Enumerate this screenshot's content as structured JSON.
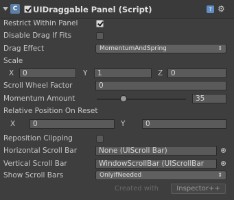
{
  "header": {
    "icon_letter": "C",
    "title": "UIDraggable Panel (Script)",
    "enabled": true
  },
  "fields": {
    "restrict_within_panel": {
      "label": "Restrict Within Panel",
      "checked": true
    },
    "disable_drag_if_fits": {
      "label": "Disable Drag If Fits",
      "checked": false
    },
    "drag_effect": {
      "label": "Drag Effect",
      "value": "MomentumAndSpring"
    },
    "scale": {
      "label": "Scale",
      "x_label": "X",
      "x": "0",
      "y_label": "Y",
      "y": "1",
      "z_label": "Z",
      "z": "0"
    },
    "scroll_wheel_factor": {
      "label": "Scroll Wheel Factor",
      "value": "0"
    },
    "momentum_amount": {
      "label": "Momentum Amount",
      "value": "35",
      "slider_fraction": 0.28
    },
    "relative_position": {
      "label": "Relative Position On Reset",
      "x_label": "X",
      "x": "0",
      "y_label": "Y",
      "y": "0"
    },
    "reposition_clipping": {
      "label": "Reposition Clipping",
      "checked": false
    },
    "horizontal_scroll_bar": {
      "label": "Horizontal Scroll Bar",
      "value": "None (UIScroll Bar)"
    },
    "vertical_scroll_bar": {
      "label": "Vertical Scroll Bar",
      "value": "WindowScrollBar (UIScrollBar"
    },
    "show_scroll_bars": {
      "label": "Show Scroll Bars",
      "value": "OnlyIfNeeded"
    }
  },
  "footer": {
    "created_with": "Created with",
    "inspector_button": "Inspector++"
  },
  "colors": {
    "panel_bg": "#3e3e3e",
    "field_bg": "#5a5a5a",
    "text": "#c8c8c8"
  }
}
